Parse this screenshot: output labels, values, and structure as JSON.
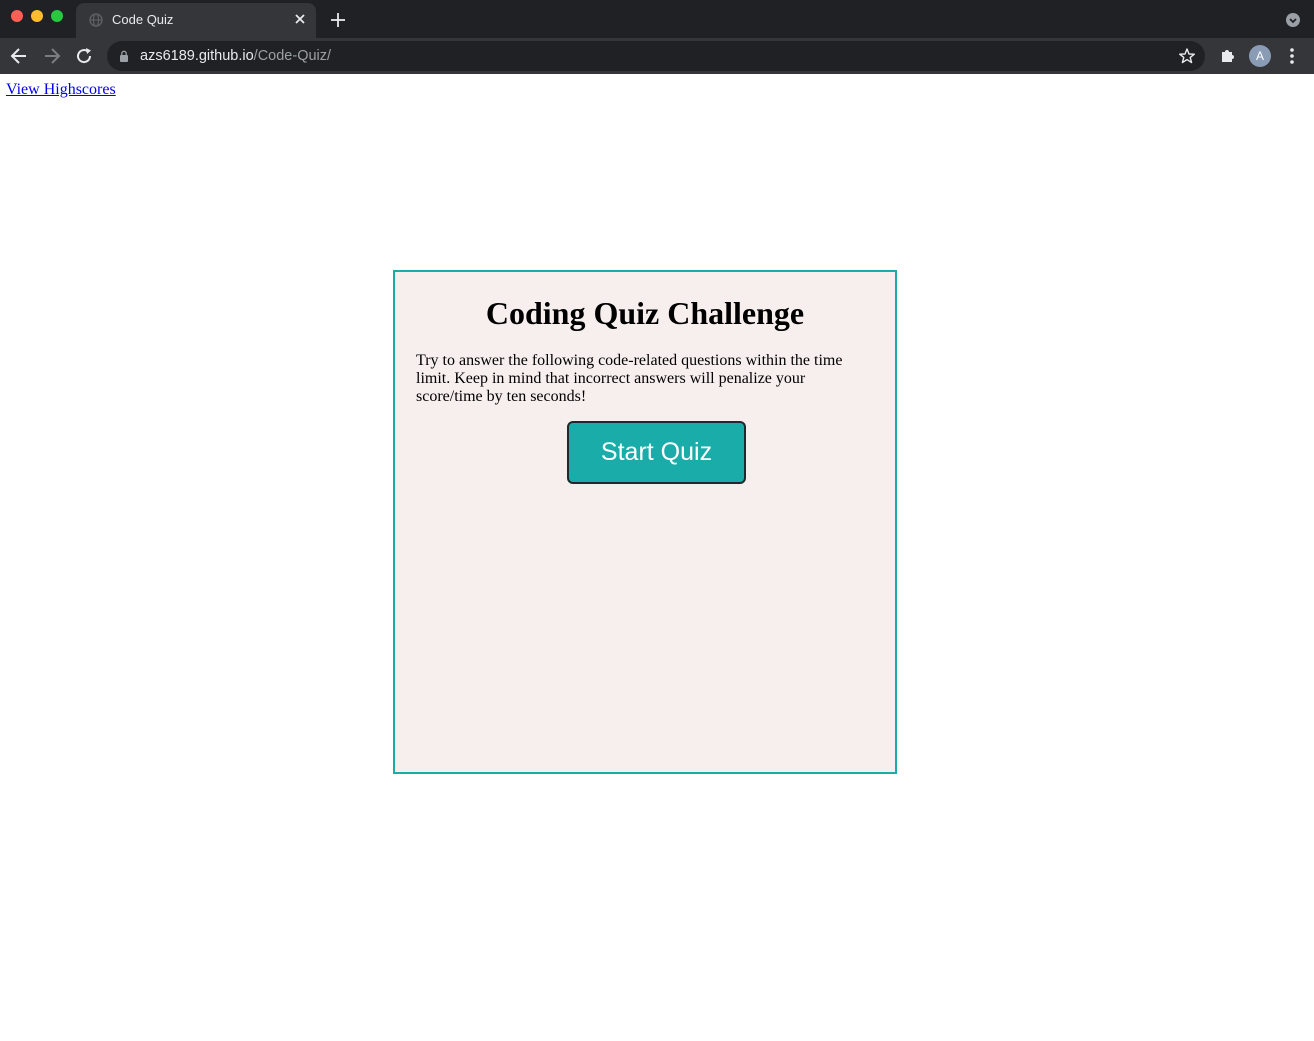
{
  "browser": {
    "tab_title": "Code Quiz",
    "url_host": "azs6189.github.io",
    "url_path": "/Code-Quiz/",
    "profile_initial": "A",
    "icons": {
      "tab_favicon": "globe-icon",
      "tab_close": "close-icon",
      "new_tab": "plus-icon",
      "back": "arrow-left-icon",
      "forward": "arrow-right-icon",
      "reload": "reload-icon",
      "lock": "lock-icon",
      "bookmark": "star-icon",
      "extensions": "puzzle-icon",
      "menu": "more-vert-icon"
    }
  },
  "page": {
    "highscores_link": "View Highscores",
    "quiz": {
      "title": "Coding Quiz Challenge",
      "description": "Try to answer the following code-related questions within the time limit. Keep in mind that incorrect answers will penalize your score/time by ten seconds!",
      "start_button": "Start Quiz"
    }
  },
  "colors": {
    "accent": "#1aaca8",
    "card_background": "#f7efed",
    "link": "#0000ee",
    "chrome_dark": "#202124",
    "chrome_toolbar": "#35363a"
  }
}
